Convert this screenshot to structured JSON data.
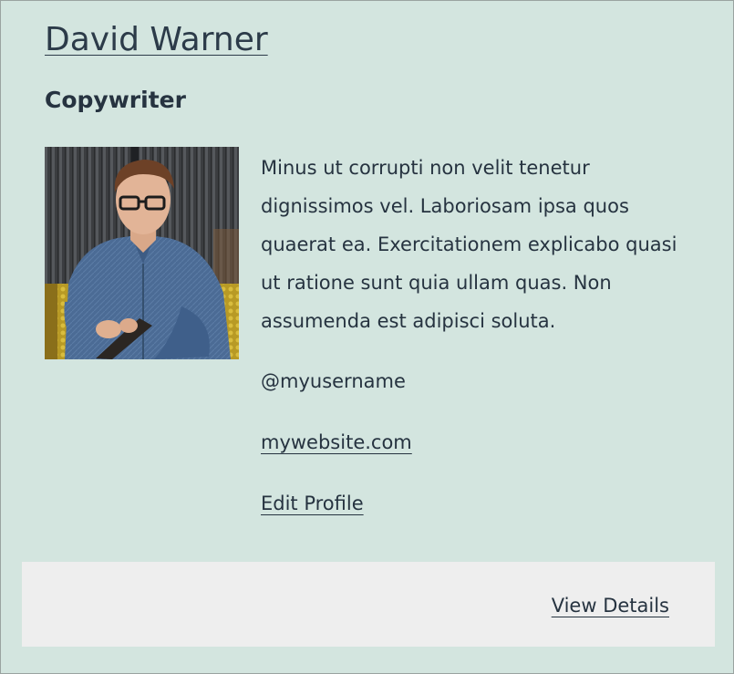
{
  "profile": {
    "name": "David Warner",
    "title": "Copywriter",
    "bio": "Minus ut corrupti non velit tenetur dignissimos vel. Laboriosam ipsa quos quaerat ea. Exercitationem explicabo quasi ut ratione sunt quia ullam quas. Non assumenda est adipisci soluta.",
    "username": "@myusername",
    "website": "mywebsite.com",
    "edit_label": "Edit Profile"
  },
  "footer": {
    "view_details_label": "View Details"
  },
  "colors": {
    "card_background": "#d3e5df",
    "footer_background": "#eeeeee",
    "text": "#263340"
  }
}
